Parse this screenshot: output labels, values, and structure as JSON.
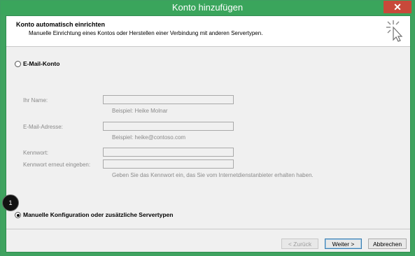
{
  "window": {
    "title": "Konto hinzufügen",
    "close_label": "✕"
  },
  "header": {
    "title": "Konto automatisch einrichten",
    "subtitle": "Manuelle Einrichtung eines Kontos oder Herstellen einer Verbindung mit anderen Servertypen.",
    "icon": "cursor-click-icon"
  },
  "options": {
    "email_account": {
      "label": "E-Mail-Konto",
      "selected": false
    },
    "manual": {
      "label": "Manuelle Konfiguration oder zusätzliche Servertypen",
      "selected": true
    }
  },
  "form": {
    "name_label": "Ihr Name:",
    "name_value": "",
    "name_hint": "Beispiel: Heike Molnar",
    "email_label": "E-Mail-Adresse:",
    "email_value": "",
    "email_hint": "Beispiel: heike@contoso.com",
    "password_label": "Kennwort:",
    "password_value": "",
    "password_confirm_label": "Kennwort erneut eingeben:",
    "password_confirm_value": "",
    "password_hint": "Geben Sie das Kennwort ein, das Sie vom Internetdienstanbieter erhalten haben."
  },
  "step_badge": "1",
  "buttons": {
    "back": "< Zurück",
    "next": "Weiter >",
    "cancel": "Abbrechen"
  }
}
